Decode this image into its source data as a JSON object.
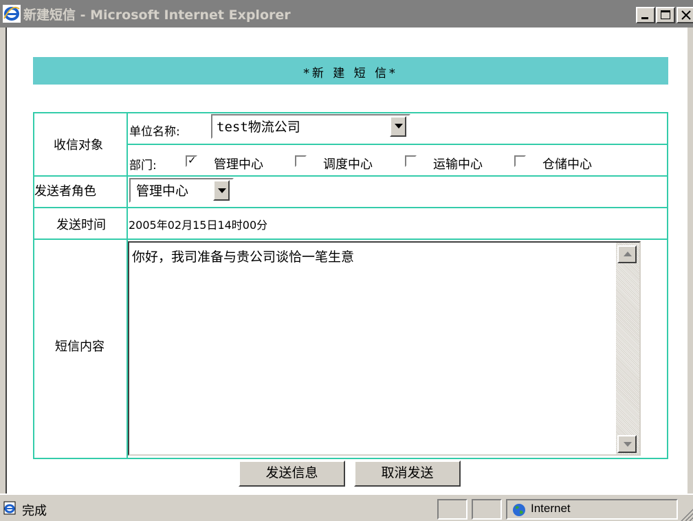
{
  "window": {
    "title": "新建短信 - Microsoft Internet Explorer"
  },
  "page": {
    "heading": "*新 建 短 信*"
  },
  "form": {
    "recipient_label": "收信对象",
    "company_label": "单位名称:",
    "company_value": "test物流公司",
    "department_label": "部门:",
    "departments": [
      {
        "label": "管理中心",
        "checked": true
      },
      {
        "label": "调度中心",
        "checked": false
      },
      {
        "label": "运输中心",
        "checked": false
      },
      {
        "label": "仓储中心",
        "checked": false
      }
    ],
    "sender_role_label": "发送者角色",
    "sender_role_value": "管理中心",
    "send_time_label": "发送时间",
    "send_time_value": "2005年02月15日14时00分",
    "content_label": "短信内容",
    "content_value": "你好，我司准备与贵公司谈恰一笔生意",
    "send_button": "发送信息",
    "cancel_button": "取消发送"
  },
  "status": {
    "text": "完成",
    "zone": "Internet"
  },
  "colors": {
    "header_bg": "#66cccc",
    "table_border": "#33ccaa",
    "titlebar_bg": "#808080"
  }
}
